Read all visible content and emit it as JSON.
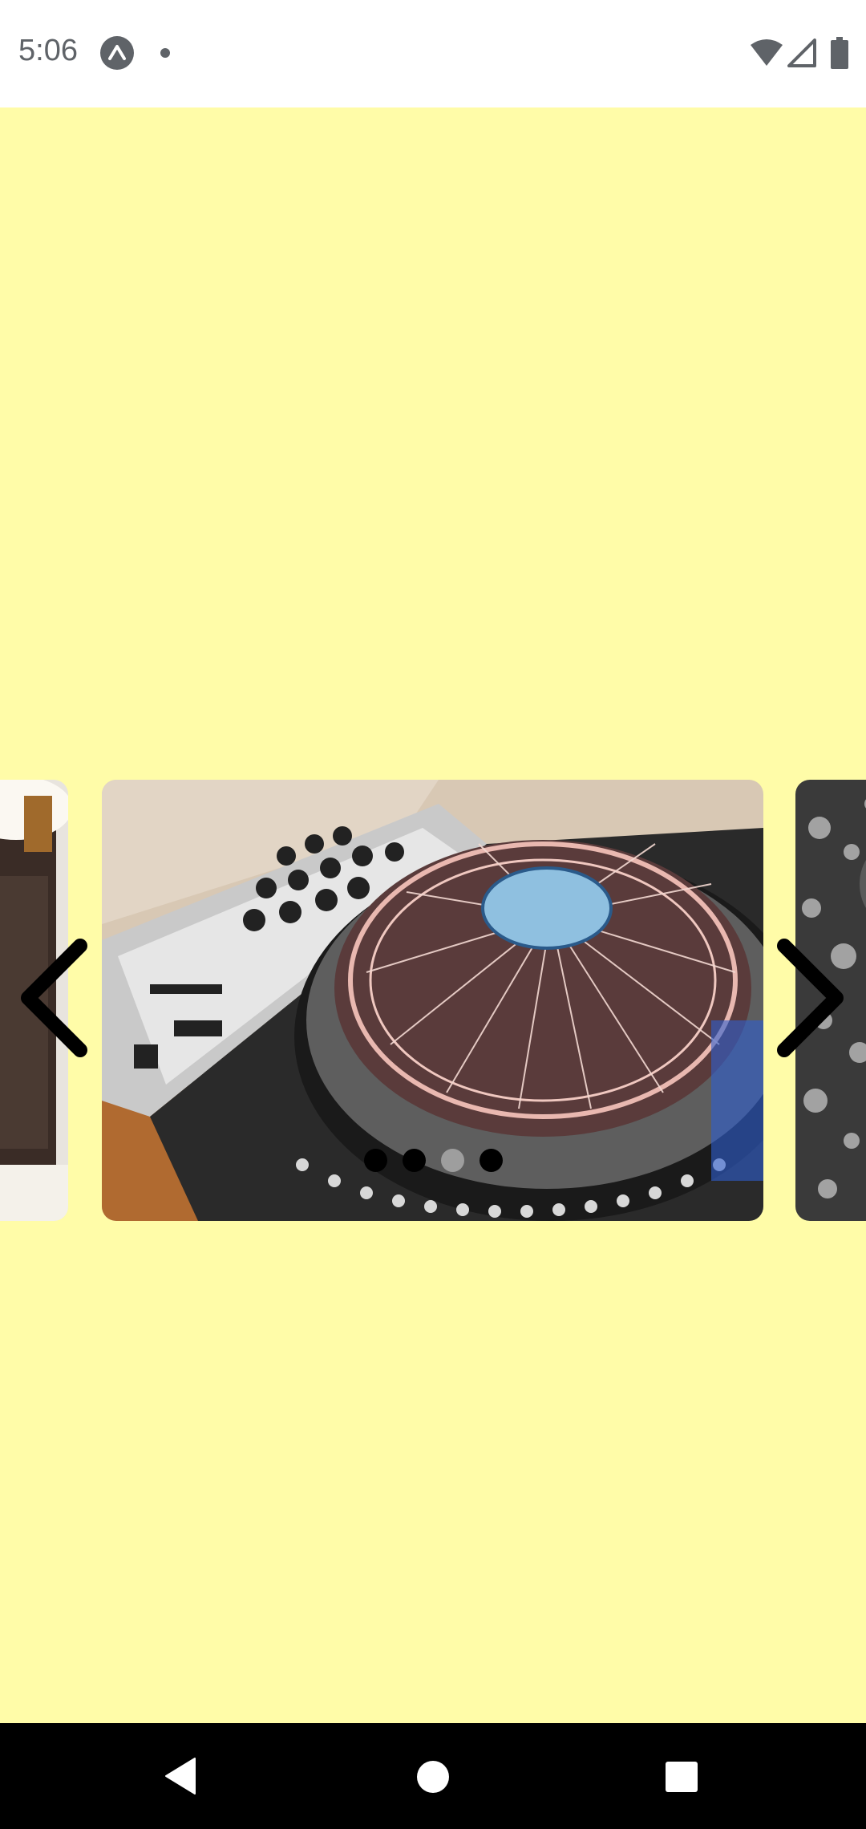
{
  "status_bar": {
    "time": "5:06",
    "app_icon": "expo-icon",
    "notification_dot": "dot-icon",
    "icons": [
      "wifi-icon",
      "cellular-signal-icon",
      "battery-icon"
    ]
  },
  "background_color": "#fffca8",
  "carousel": {
    "slides": [
      {
        "image": "coffee-cup-photo"
      },
      {
        "image": "dj-turntable-mixer-photo"
      },
      {
        "image": "black-and-white-photo"
      }
    ],
    "current_index": 1,
    "prev_icon": "chevron-left-icon",
    "next_icon": "chevron-right-icon"
  },
  "pagination": {
    "count": 4,
    "active_index": 2,
    "active_color": "#9e9e9e",
    "inactive_color": "#000000"
  },
  "nav_bar": {
    "buttons": [
      "back-icon",
      "home-icon",
      "recents-icon"
    ]
  }
}
